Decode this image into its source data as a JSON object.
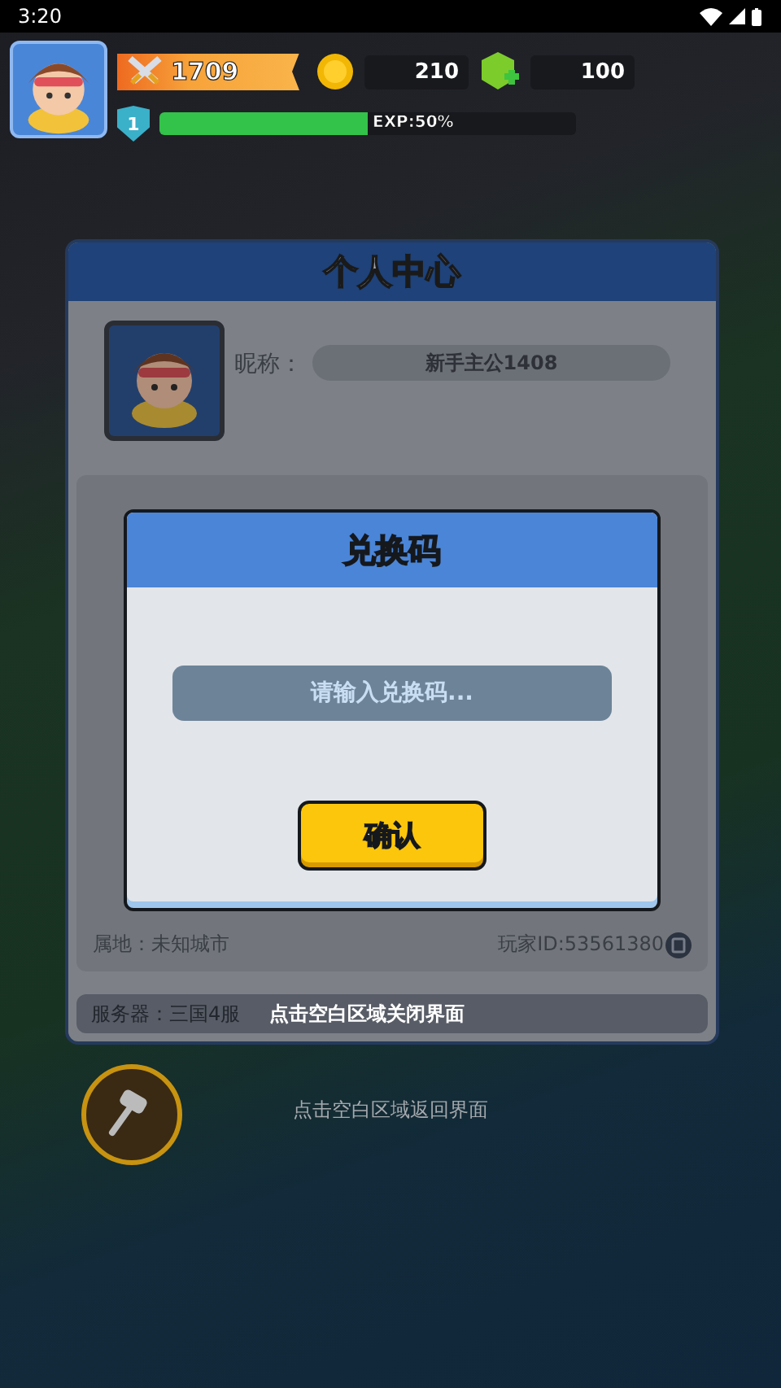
{
  "status_bar": {
    "time": "3:20"
  },
  "hud": {
    "power": "1709",
    "coins": "210",
    "gems": "100",
    "player_level": "1",
    "exp": {
      "label": "EXP:50%",
      "level": 0.5
    }
  },
  "profile": {
    "title": "个人中心",
    "nickname_label": "昵称：",
    "nickname": "新手主公1408",
    "location": "属地：未知城市",
    "player_id": "玩家ID:53561380",
    "server": "服务器：三国4服"
  },
  "redeem_dialog": {
    "title": "兑换码",
    "placeholder": "请输入兑换码...",
    "confirm": "确认"
  },
  "hints": [
    "点击空白区域关闭界面",
    "点击空白区域返回界面"
  ]
}
